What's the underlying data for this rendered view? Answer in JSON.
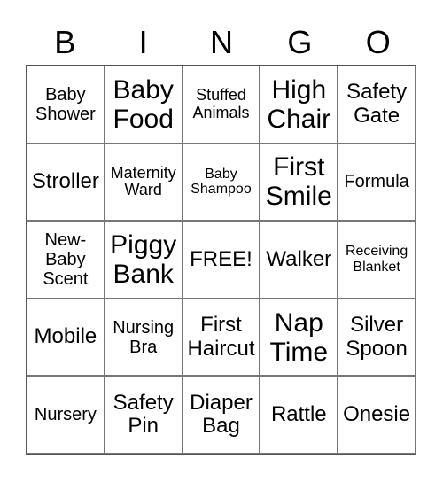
{
  "header": [
    "B",
    "I",
    "N",
    "G",
    "O"
  ],
  "cells": [
    [
      "Baby\nShower",
      "Baby\nFood",
      "Stuffed\nAnimals",
      "High\nChair",
      "Safety\nGate"
    ],
    [
      "Stroller",
      "Maternity\nWard",
      "Baby\nShampoo",
      "First\nSmile",
      "Formula"
    ],
    [
      "New-\nBaby\nScent",
      "Piggy\nBank",
      "FREE!",
      "Walker",
      "Receiving\nBlanket"
    ],
    [
      "Mobile",
      "Nursing\nBra",
      "First\nHaircut",
      "Nap\nTime",
      "Silver\nSpoon"
    ],
    [
      "Nursery",
      "Safety\nPin",
      "Diaper\nBag",
      "Rattle",
      "Onesie"
    ]
  ]
}
